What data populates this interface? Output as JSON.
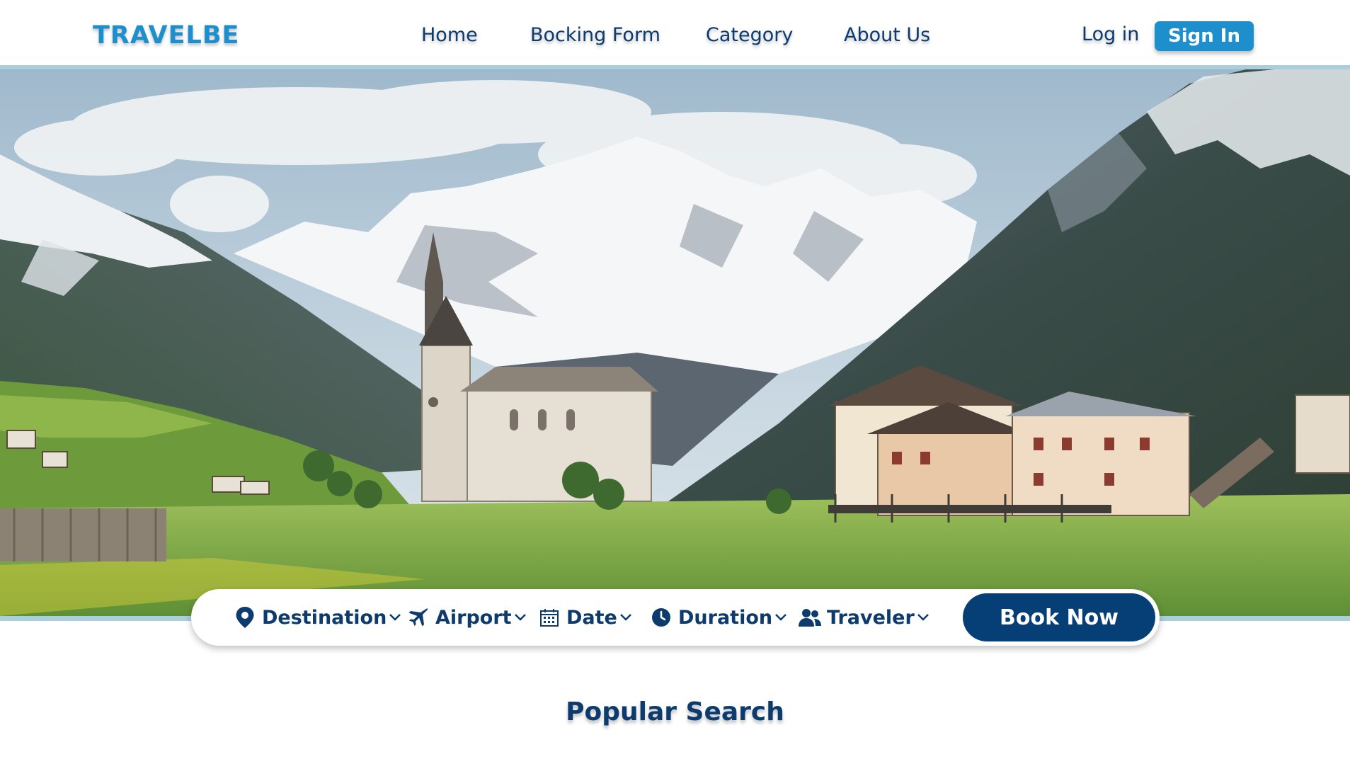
{
  "brand": {
    "logo": "TRAVELBE"
  },
  "nav": {
    "items": [
      {
        "label": "Home"
      },
      {
        "label": "Bocking Form"
      },
      {
        "label": "Category"
      },
      {
        "label": "About Us"
      }
    ],
    "login_label": "Log in",
    "signin_label": "Sign In"
  },
  "hero": {
    "image_subject": "alpine village with church steeple beneath snowy mountains"
  },
  "search": {
    "fields": [
      {
        "label": "Destination",
        "icon": "map-pin-icon"
      },
      {
        "label": "Airport",
        "icon": "airplane-icon"
      },
      {
        "label": "Date",
        "icon": "calendar-icon"
      },
      {
        "label": "Duration",
        "icon": "clock-icon"
      },
      {
        "label": "Traveler",
        "icon": "users-icon"
      }
    ],
    "book_label": "Book Now"
  },
  "sections": {
    "popular_title": "Popular Search"
  },
  "colors": {
    "brand_blue": "#1d8fcc",
    "navy": "#0d3b6e",
    "button_navy": "#063f75",
    "hero_band": "#a9cfdc"
  }
}
